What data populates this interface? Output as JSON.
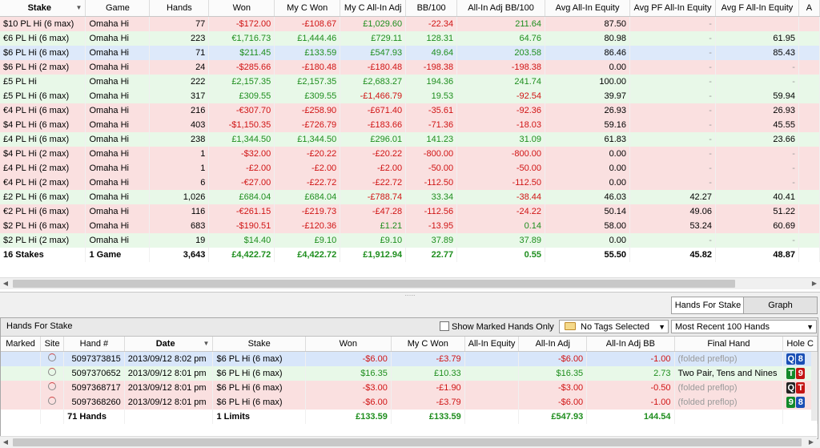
{
  "top_table": {
    "columns": [
      "Stake",
      "Game",
      "Hands",
      "Won",
      "My C Won",
      "My C All-In Adj",
      "BB/100",
      "All-In Adj BB/100",
      "Avg All-In Equity",
      "Avg PF All-In Equity",
      "Avg F All-In Equity",
      "A"
    ],
    "rows": [
      {
        "style": "red",
        "cells": [
          "$10 PL Hi (6 max)",
          "Omaha Hi",
          "77",
          "-$172.00",
          "-£108.67",
          "£1,029.60",
          "-22.34",
          "211.64",
          "87.50",
          "-",
          ""
        ]
      },
      {
        "style": "green",
        "cells": [
          "€6 PL Hi (6 max)",
          "Omaha Hi",
          "223",
          "€1,716.73",
          "£1,444.46",
          "£729.11",
          "128.31",
          "64.76",
          "80.98",
          "-",
          "61.95"
        ]
      },
      {
        "style": "blue",
        "cells": [
          "$6 PL Hi (6 max)",
          "Omaha Hi",
          "71",
          "$211.45",
          "£133.59",
          "£547.93",
          "49.64",
          "203.58",
          "86.46",
          "-",
          "85.43"
        ]
      },
      {
        "style": "red",
        "cells": [
          "$6 PL Hi (2 max)",
          "Omaha Hi",
          "24",
          "-$285.66",
          "-£180.48",
          "-£180.48",
          "-198.38",
          "-198.38",
          "0.00",
          "-",
          "-"
        ]
      },
      {
        "style": "green",
        "cells": [
          "£5 PL Hi",
          "Omaha Hi",
          "222",
          "£2,157.35",
          "£2,157.35",
          "£2,683.27",
          "194.36",
          "241.74",
          "100.00",
          "-",
          "-"
        ]
      },
      {
        "style": "green",
        "cells": [
          "£5 PL Hi (6 max)",
          "Omaha Hi",
          "317",
          "£309.55",
          "£309.55",
          "-£1,466.79",
          "19.53",
          "-92.54",
          "39.97",
          "-",
          "59.94"
        ]
      },
      {
        "style": "red",
        "cells": [
          "€4 PL Hi (6 max)",
          "Omaha Hi",
          "216",
          "-€307.70",
          "-£258.90",
          "-£671.40",
          "-35.61",
          "-92.36",
          "26.93",
          "-",
          "26.93"
        ]
      },
      {
        "style": "red",
        "cells": [
          "$4 PL Hi (6 max)",
          "Omaha Hi",
          "403",
          "-$1,150.35",
          "-£726.79",
          "-£183.66",
          "-71.36",
          "-18.03",
          "59.16",
          "-",
          "45.55"
        ]
      },
      {
        "style": "green",
        "cells": [
          "£4 PL Hi (6 max)",
          "Omaha Hi",
          "238",
          "£1,344.50",
          "£1,344.50",
          "£296.01",
          "141.23",
          "31.09",
          "61.83",
          "-",
          "23.66"
        ]
      },
      {
        "style": "red",
        "cells": [
          "$4 PL Hi (2 max)",
          "Omaha Hi",
          "1",
          "-$32.00",
          "-£20.22",
          "-£20.22",
          "-800.00",
          "-800.00",
          "0.00",
          "-",
          "-"
        ]
      },
      {
        "style": "red",
        "cells": [
          "£4 PL Hi (2 max)",
          "Omaha Hi",
          "1",
          "-£2.00",
          "-£2.00",
          "-£2.00",
          "-50.00",
          "-50.00",
          "0.00",
          "-",
          "-"
        ]
      },
      {
        "style": "red",
        "cells": [
          "€4 PL Hi (2 max)",
          "Omaha Hi",
          "6",
          "-€27.00",
          "-£22.72",
          "-£22.72",
          "-112.50",
          "-112.50",
          "0.00",
          "-",
          "-"
        ]
      },
      {
        "style": "green",
        "cells": [
          "£2 PL Hi (6 max)",
          "Omaha Hi",
          "1,026",
          "£684.04",
          "£684.04",
          "-£788.74",
          "33.34",
          "-38.44",
          "46.03",
          "42.27",
          "40.41"
        ]
      },
      {
        "style": "red",
        "cells": [
          "€2 PL Hi (6 max)",
          "Omaha Hi",
          "116",
          "-€261.15",
          "-£219.73",
          "-£47.28",
          "-112.56",
          "-24.22",
          "50.14",
          "49.06",
          "51.22"
        ]
      },
      {
        "style": "red",
        "cells": [
          "$2 PL Hi (6 max)",
          "Omaha Hi",
          "683",
          "-$190.51",
          "-£120.36",
          "£1.21",
          "-13.95",
          "0.14",
          "58.00",
          "53.24",
          "60.69"
        ]
      },
      {
        "style": "green",
        "cells": [
          "$2 PL Hi (2 max)",
          "Omaha Hi",
          "19",
          "$14.40",
          "£9.10",
          "£9.10",
          "37.89",
          "37.89",
          "0.00",
          "-",
          "-"
        ]
      }
    ],
    "totals": [
      "16 Stakes",
      "1 Game",
      "3,643",
      "£4,422.72",
      "£4,422.72",
      "£1,912.94",
      "22.77",
      "0.55",
      "55.50",
      "45.82",
      "48.87"
    ]
  },
  "splitter_grip": "......",
  "tabs": {
    "hands_for_stake": "Hands For Stake",
    "graph": "Graph"
  },
  "bottom_panel": {
    "title": "Hands For Stake",
    "show_marked_label": "Show Marked Hands Only",
    "tags_dropdown": "No Tags Selected",
    "recent_dropdown": "Most Recent 100 Hands",
    "columns": [
      "Marked",
      "Site",
      "Hand #",
      "Date",
      "Stake",
      "Won",
      "My C Won",
      "All-In Equity",
      "All-In Adj",
      "All-In Adj BB",
      "Final Hand",
      "Hole C"
    ],
    "rows": [
      {
        "style": "sel",
        "hand": "5097373815",
        "date": "2013/09/12  8:02 pm",
        "stake": "$6 PL Hi (6 max)",
        "won": "-$6.00",
        "mycwon": "-£3.79",
        "equity": "",
        "adj": "-$6.00",
        "adjbb": "-1.00",
        "final": "(folded preflop)",
        "final_muted": true,
        "cards": [
          {
            "r": "Q",
            "c": "blue"
          },
          {
            "r": "8",
            "c": "blue"
          }
        ]
      },
      {
        "style": "green",
        "hand": "5097370652",
        "date": "2013/09/12  8:01 pm",
        "stake": "$6 PL Hi (6 max)",
        "won": "$16.35",
        "mycwon": "£10.33",
        "equity": "",
        "adj": "$16.35",
        "adjbb": "2.73",
        "final": "Two Pair, Tens and Nines",
        "final_muted": false,
        "cards": [
          {
            "r": "T",
            "c": "green"
          },
          {
            "r": "9",
            "c": "red"
          }
        ]
      },
      {
        "style": "red",
        "hand": "5097368717",
        "date": "2013/09/12  8:01 pm",
        "stake": "$6 PL Hi (6 max)",
        "won": "-$3.00",
        "mycwon": "-£1.90",
        "equity": "",
        "adj": "-$3.00",
        "adjbb": "-0.50",
        "final": "(folded preflop)",
        "final_muted": true,
        "cards": [
          {
            "r": "Q",
            "c": "black"
          },
          {
            "r": "T",
            "c": "red"
          }
        ]
      },
      {
        "style": "red",
        "hand": "5097368260",
        "date": "2013/09/12  8:01 pm",
        "stake": "$6 PL Hi (6 max)",
        "won": "-$6.00",
        "mycwon": "-£3.79",
        "equity": "",
        "adj": "-$6.00",
        "adjbb": "-1.00",
        "final": "(folded preflop)",
        "final_muted": true,
        "cards": [
          {
            "r": "9",
            "c": "green"
          },
          {
            "r": "8",
            "c": "blue"
          }
        ]
      }
    ],
    "totals": {
      "hands": "71 Hands",
      "limits": "1 Limits",
      "won": "£133.59",
      "mycwon": "£133.59",
      "adj": "£547.93",
      "adjbb": "144.54"
    }
  }
}
